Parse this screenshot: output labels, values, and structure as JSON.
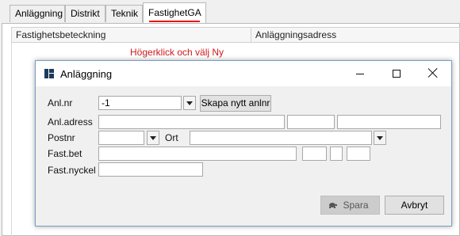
{
  "tabs": [
    {
      "label": "Anläggning"
    },
    {
      "label": "Distrikt"
    },
    {
      "label": "Teknik"
    },
    {
      "label": "FastighetGA",
      "active": true
    }
  ],
  "table": {
    "columns": [
      "Fastighetsbeteckning",
      "Anläggningsadress"
    ]
  },
  "instruction": "Högerklick och välj Ny",
  "dialog": {
    "title": "Anläggning",
    "fields": {
      "anl_nr": {
        "label": "Anl.nr",
        "value": "-1"
      },
      "anl_adress": {
        "label": "Anl.adress"
      },
      "postnr": {
        "label": "Postnr"
      },
      "ort": {
        "label": "Ort"
      },
      "fast_bet": {
        "label": "Fast.bet"
      },
      "fast_nyckel": {
        "label": "Fast.nyckel"
      }
    },
    "buttons": {
      "create": "Skapa nytt anlnr",
      "save": "Spara",
      "cancel": "Avbryt"
    }
  },
  "colors": {
    "accent": "#e11111",
    "instruction": "#d0191d",
    "dialog_border": "#7a9cc6"
  },
  "icons": {
    "app": "app-grid-icon",
    "save": "turtle-icon",
    "dropdown": "chevron-down-icon"
  }
}
